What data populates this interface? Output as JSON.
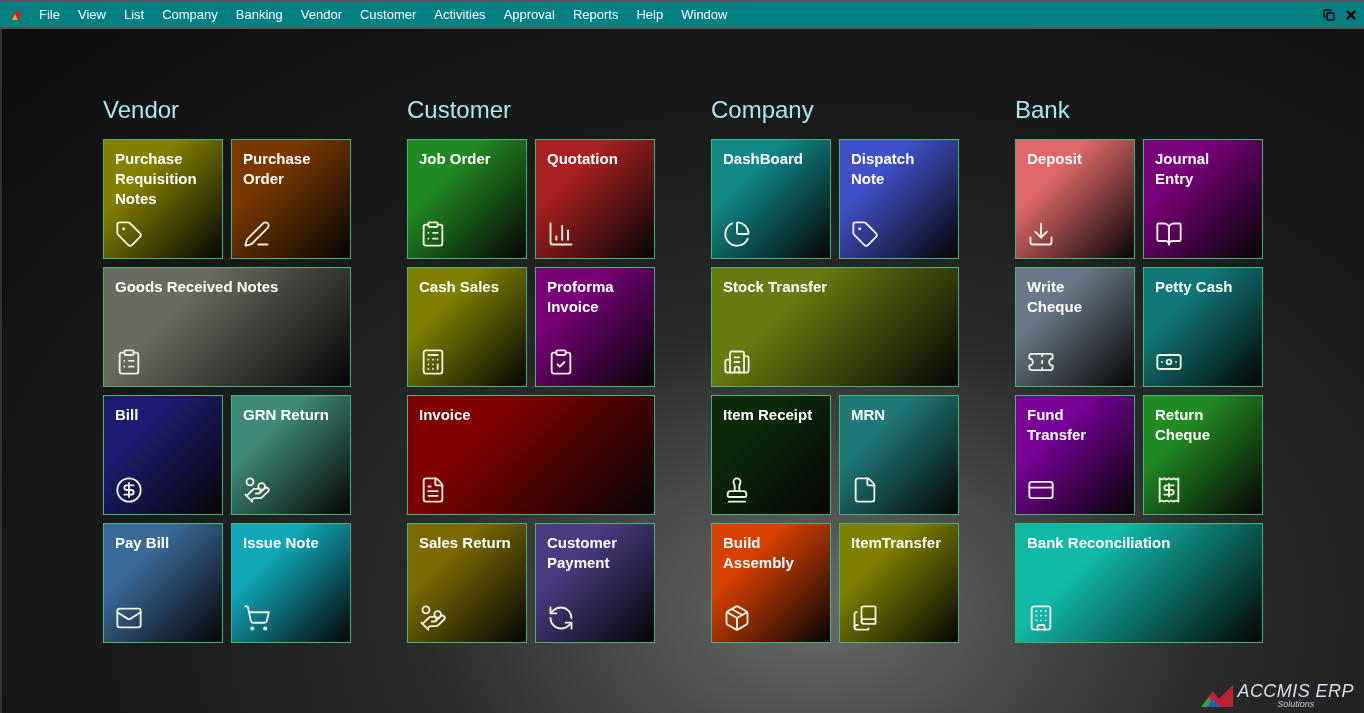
{
  "menu_bar": {
    "items": [
      "File",
      "View",
      "List",
      "Company",
      "Banking",
      "Vendor",
      "Customer",
      "Activities",
      "Approval",
      "Reports",
      "Help",
      "Window"
    ]
  },
  "groups": [
    {
      "title": "Vendor",
      "tiles": [
        {
          "label": "Purchase Requisition Notes",
          "wide": false,
          "color": "#858000"
        },
        {
          "label": "Purchase Order",
          "wide": false,
          "color": "#7a3800"
        },
        {
          "label": "Goods Received Notes",
          "wide": true,
          "color": "#6a6a60"
        },
        {
          "label": "Bill",
          "wide": false,
          "color": "#1c1c70"
        },
        {
          "label": "GRN Return",
          "wide": false,
          "color": "#3e8a78"
        },
        {
          "label": "Pay Bill",
          "wide": false,
          "color": "#3a6a9a"
        },
        {
          "label": "Issue Note",
          "wide": false,
          "color": "#10a8b8"
        }
      ]
    },
    {
      "title": "Customer",
      "tiles": [
        {
          "label": "Job Order",
          "wide": false,
          "color": "#228a22"
        },
        {
          "label": "Quotation",
          "wide": false,
          "color": "#a82020"
        },
        {
          "label": "Cash Sales",
          "wide": false,
          "color": "#808000"
        },
        {
          "label": "Proforma Invoice",
          "wide": false,
          "color": "#760076"
        },
        {
          "label": "Invoice",
          "wide": true,
          "color": "#800000"
        },
        {
          "label": "Sales Return",
          "wide": false,
          "color": "#7a6a00"
        },
        {
          "label": "Customer Payment",
          "wide": false,
          "color": "#4a3a80"
        }
      ]
    },
    {
      "title": "Company",
      "tiles": [
        {
          "label": "DashBoard",
          "wide": false,
          "color": "#108888"
        },
        {
          "label": "Dispatch Note",
          "wide": false,
          "color": "#4050c8"
        },
        {
          "label": "Stock Transfer",
          "wide": true,
          "color": "#6a7a10"
        },
        {
          "label": "Item Receipt",
          "wide": false,
          "color": "#0a2a0a"
        },
        {
          "label": "MRN",
          "wide": false,
          "color": "#207878"
        },
        {
          "label": "Build Assembly",
          "wide": false,
          "color": "#d84000"
        },
        {
          "label": "ItemTransfer",
          "wide": false,
          "color": "#808000"
        }
      ]
    },
    {
      "title": "Bank",
      "tiles": [
        {
          "label": "Deposit",
          "wide": false,
          "color": "#e06868"
        },
        {
          "label": "Journal Entry",
          "wide": false,
          "color": "#780078"
        },
        {
          "label": "Write Cheque",
          "wide": false,
          "color": "#687888"
        },
        {
          "label": "Petty Cash",
          "wide": false,
          "color": "#107878"
        },
        {
          "label": "Fund Transfer",
          "wide": false,
          "color": "#780098"
        },
        {
          "label": "Return Cheque",
          "wide": false,
          "color": "#228a22"
        },
        {
          "label": "Bank Reconciliation",
          "wide": true,
          "color": "#10b8a8"
        }
      ]
    }
  ],
  "logo": {
    "name": "ACCMIS ERP",
    "tagline": "Solutions"
  }
}
